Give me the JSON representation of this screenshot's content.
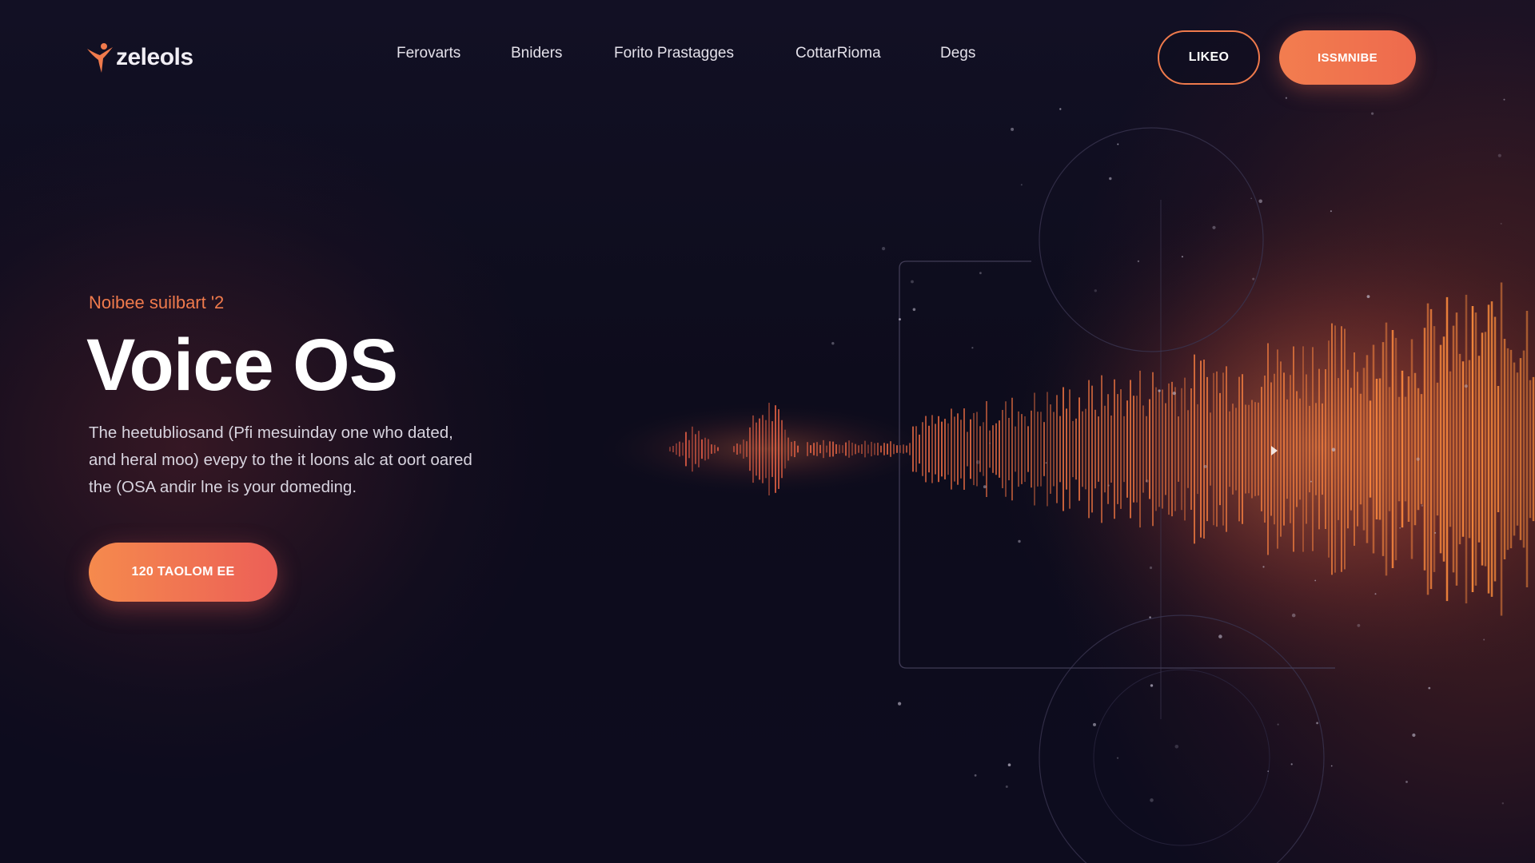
{
  "brand": {
    "name": "zeleols",
    "logo_icon": "dancing-figure-icon"
  },
  "nav": {
    "items": [
      {
        "label": "Ferovarts"
      },
      {
        "label": "Bniders"
      },
      {
        "label": "Forito Prastagges"
      },
      {
        "label": "CottarRioma"
      },
      {
        "label": "Degs"
      }
    ]
  },
  "header_actions": {
    "login_label": "LIKEO",
    "signup_label": "ISSMNIBE"
  },
  "hero": {
    "eyebrow": "Noibee suilbart '2",
    "title": "Voice OS",
    "description_lines": [
      "The heetubliosand (Pfi mesuinday one who dated,",
      "and heral moo) evepy to the it loons alc at oort oared",
      "the (OSA andir lne is your domeding."
    ],
    "cta_label": "120 TAOLOM EE"
  },
  "colors": {
    "accent": "#ef7a4c",
    "accent_pink": "#ec5f57",
    "background": "#0d0c1c",
    "text": "#ffffff"
  }
}
